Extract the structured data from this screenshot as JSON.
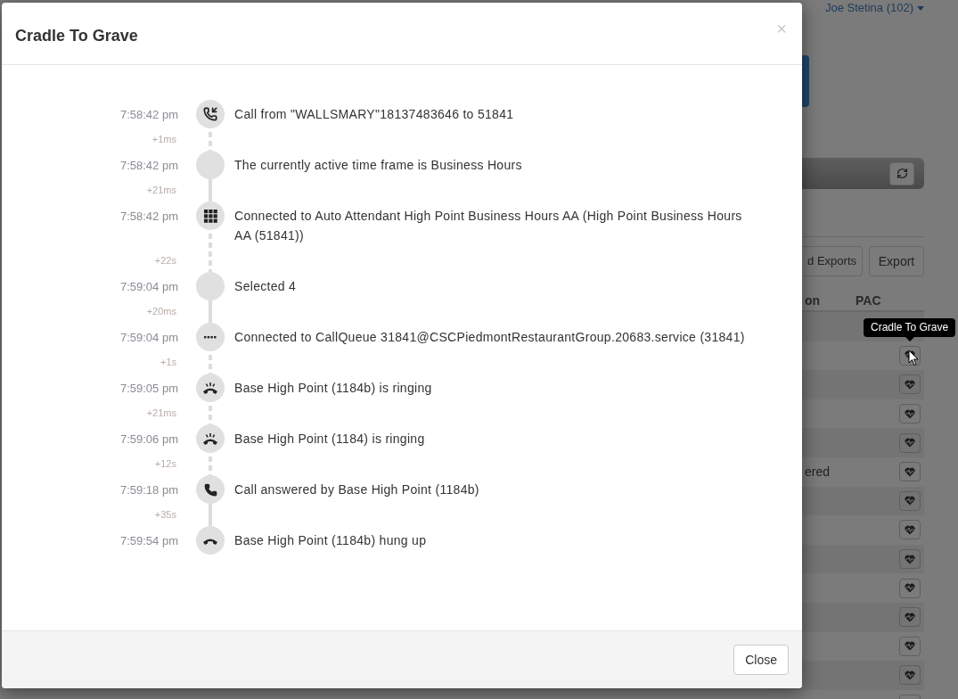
{
  "page": {
    "user_menu": "Joe Stetina (102)",
    "exports_buttons": [
      "d Exports",
      "Export"
    ],
    "table": {
      "columns": [
        "on",
        "PAC"
      ],
      "rows": [
        {
          "c2g_button": false
        },
        {
          "c2g_button": true
        },
        {
          "c2g_button": true
        },
        {
          "c2g_button": true
        },
        {
          "c2g_button": true
        },
        {
          "c2g_button": true,
          "status": "ered"
        },
        {
          "c2g_button": true
        },
        {
          "c2g_button": true
        },
        {
          "c2g_button": true
        },
        {
          "c2g_button": true
        },
        {
          "c2g_button": true
        },
        {
          "c2g_button": true
        },
        {
          "c2g_button": true
        },
        {
          "c2g_button": true
        }
      ]
    },
    "tooltip": "Cradle To Grave"
  },
  "dialog": {
    "title": "Cradle To Grave",
    "close_symbol": "×",
    "events": [
      {
        "time": "7:58:42 pm",
        "kind": "incoming",
        "text": "Call from \"WALLSMARY\"18137483646 to 51841",
        "delta": "+1ms",
        "dashed": true
      },
      {
        "time": "7:58:42 pm",
        "kind": "none",
        "text": "The currently active time frame is Business Hours",
        "delta": "+21ms",
        "dashed": false
      },
      {
        "time": "7:58:42 pm",
        "kind": "keypad",
        "text": "Connected to Auto Attendant High Point Business Hours AA (High Point Business Hours AA (51841))",
        "delta": "+22s",
        "dashed": true
      },
      {
        "time": "7:59:04 pm",
        "kind": "none",
        "text": "Selected 4",
        "delta": "+20ms",
        "dashed": false
      },
      {
        "time": "7:59:04 pm",
        "kind": "queue",
        "text": "Connected to CallQueue 31841@CSCPiedmontRestaurantGroup.20683.service (31841)",
        "delta": "+1s",
        "dashed": true
      },
      {
        "time": "7:59:05 pm",
        "kind": "ringing",
        "text": "Base High Point (1184b) is ringing",
        "delta": "+21ms",
        "dashed": true
      },
      {
        "time": "7:59:06 pm",
        "kind": "ringing",
        "text": "Base High Point (1184) is ringing",
        "delta": "+12s",
        "dashed": true
      },
      {
        "time": "7:59:18 pm",
        "kind": "answered",
        "text": "Call answered by Base High Point (1184b)",
        "delta": "+35s",
        "dashed": false
      },
      {
        "time": "7:59:54 pm",
        "kind": "hangup",
        "text": "Base High Point (1184b) hung up"
      }
    ],
    "buttons": [
      "Close"
    ]
  }
}
